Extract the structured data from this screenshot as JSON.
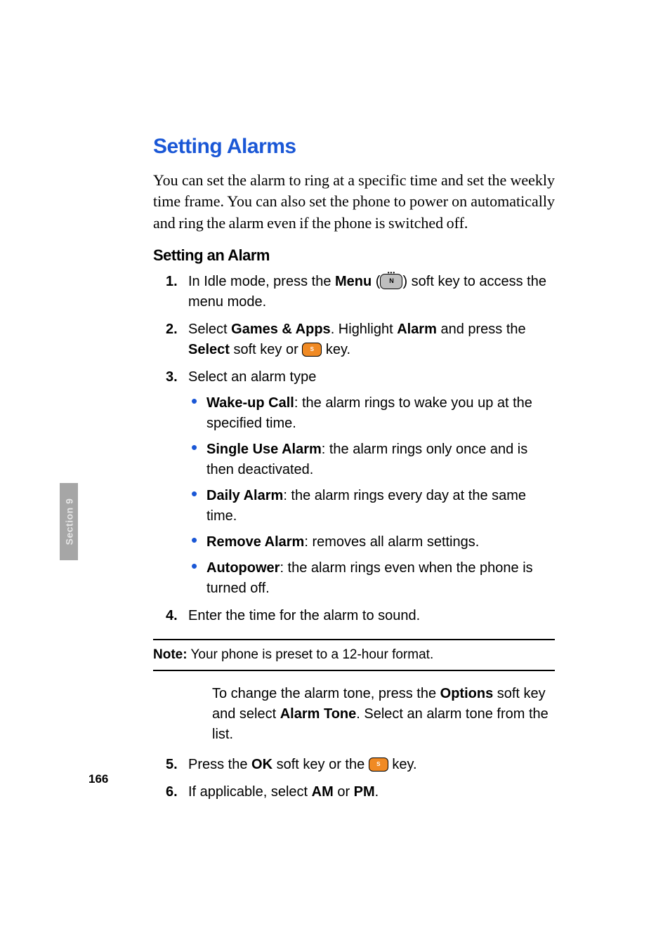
{
  "sideTab": "Section 9",
  "pageNumber": "166",
  "title": "Setting Alarms",
  "intro": "You can set the alarm to ring at a specific time and set the weekly time frame. You can also set the phone to power on automatically and ring the alarm even if the phone is switched off.",
  "subheading": "Setting an Alarm",
  "steps": {
    "s1_a": "In Idle mode, press the ",
    "s1_menu": "Menu",
    "s1_b": " (",
    "s1_c": ") soft key to access the menu mode.",
    "s2_a": "Select ",
    "s2_games": "Games & Apps",
    "s2_b": ". Highlight ",
    "s2_alarm": "Alarm",
    "s2_c": " and press the ",
    "s2_select": "Select",
    "s2_d": " soft key or ",
    "s2_e": " key.",
    "s3": " Select an alarm type",
    "s4": " Enter the time for the alarm to sound.",
    "s5_a": " Press the ",
    "s5_ok": "OK",
    "s5_b": " soft key or the ",
    "s5_c": " key.",
    "s6_a": "If applicable, select ",
    "s6_am": "AM",
    "s6_b": " or ",
    "s6_pm": "PM",
    "s6_c": "."
  },
  "bullets": {
    "b1_name": "Wake-up Call",
    "b1_text": ": the alarm rings to wake you up at the specified time.",
    "b2_name": "Single Use Alarm",
    "b2_text": ": the alarm rings only once and is then deactivated.",
    "b3_name": "Daily Alarm",
    "b3_text": ": the alarm rings every day at the same time.",
    "b4_name": "Remove Alarm",
    "b4_text": ": removes all alarm settings.",
    "b5_name": "Autopower",
    "b5_text": ": the alarm rings even when the phone is turned off."
  },
  "note": {
    "label": "Note:",
    "text": " Your phone is preset to a 12-hour format."
  },
  "continuation": {
    "a": "To change the alarm tone, press the ",
    "options": "Options",
    "b": " soft key and select ",
    "alarmTone": "Alarm Tone",
    "c": ". Select an alarm tone from the list."
  },
  "keyLabels": {
    "menu": "N",
    "ok": "S"
  }
}
